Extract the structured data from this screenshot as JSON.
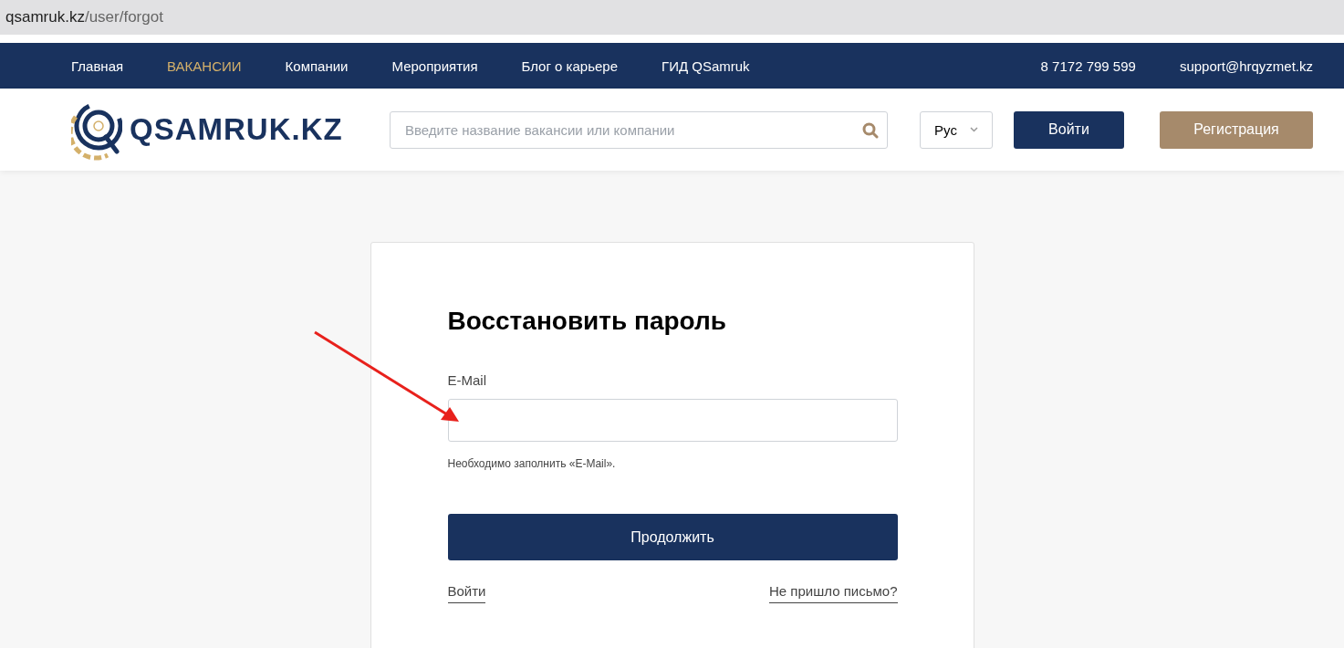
{
  "address_bar": {
    "host": "qsamruk.kz",
    "path": "/user/forgot"
  },
  "top_nav": {
    "items": [
      {
        "label": "Главная",
        "selected": false
      },
      {
        "label": "ВАКАНСИИ",
        "selected": true
      },
      {
        "label": "Компании",
        "selected": false
      },
      {
        "label": "Мероприятия",
        "selected": false
      },
      {
        "label": "Блог о карьере",
        "selected": false
      },
      {
        "label": "ГИД QSamruk",
        "selected": false
      }
    ],
    "phone": "8 7172 799 599",
    "email": "support@hrqyzmet.kz"
  },
  "header": {
    "logo_text": "QSAMRUK.KZ",
    "search": {
      "placeholder": "Введите название вакансии или компании"
    },
    "language": "Рус",
    "login_button": "Войти",
    "register_button": "Регистрация"
  },
  "form": {
    "title": "Восстановить пароль",
    "email_label": "E-Mail",
    "error": "Необходимо заполнить «E-Mail».",
    "submit": "Продолжить",
    "links": [
      "Войти",
      "Не пришло письмо?"
    ]
  }
}
